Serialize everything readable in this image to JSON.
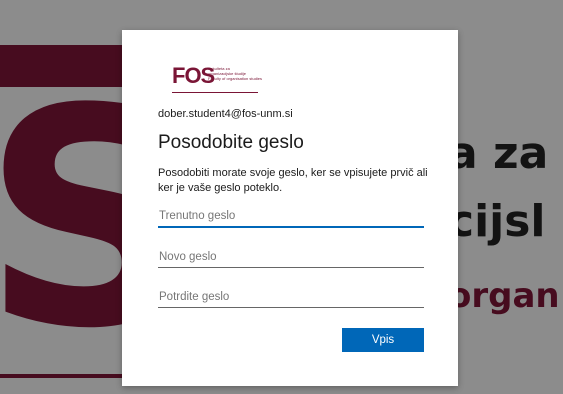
{
  "background": {
    "text_line1": "a za",
    "text_line2": "cijsl",
    "text_line3": "organ",
    "big_letter": "S"
  },
  "logo": {
    "brand": "FOS",
    "line1": "Fakulteta za",
    "line2": "organizacijske študije",
    "line3": "Faculty of organisation studies"
  },
  "dialog": {
    "username": "dober.student4@fos-unm.si",
    "title": "Posodobite geslo",
    "description": "Posodobiti morate svoje geslo, ker se vpisujete prvič ali ker je vaše geslo poteklo.",
    "current_password_placeholder": "Trenutno geslo",
    "new_password_placeholder": "Novo geslo",
    "confirm_password_placeholder": "Potrdite geslo",
    "submit_label": "Vpis"
  },
  "colors": {
    "brand": "#7a1536",
    "accent": "#0067b8"
  }
}
